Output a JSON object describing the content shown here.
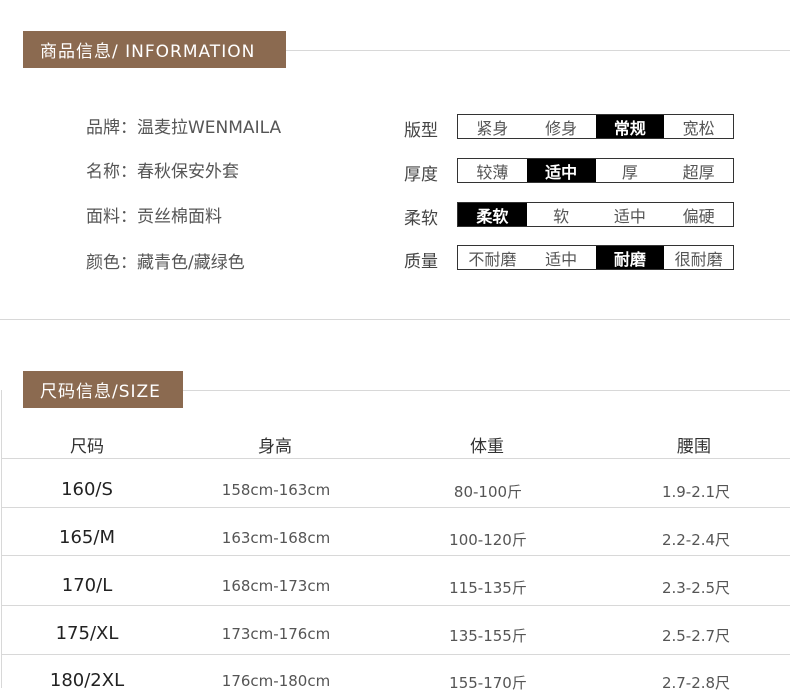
{
  "info_section": {
    "tag": "商品信息/ INFORMATION",
    "rows": [
      {
        "label": "品牌：",
        "value": "温麦拉WENMAILA"
      },
      {
        "label": "名称：",
        "value": "春秋保安外套"
      },
      {
        "label": "面料：",
        "value": "贡丝棉面料"
      },
      {
        "label": "颜色：",
        "value": "藏青色/藏绿色"
      }
    ]
  },
  "attributes": [
    {
      "label": "版型",
      "options": [
        "紧身",
        "修身",
        "常规",
        "宽松"
      ],
      "selected": 2
    },
    {
      "label": "厚度",
      "options": [
        "较薄",
        "适中",
        "厚",
        "超厚"
      ],
      "selected": 1
    },
    {
      "label": "柔软",
      "options": [
        "柔软",
        "软",
        "适中",
        "偏硬"
      ],
      "selected": 0
    },
    {
      "label": "质量",
      "options": [
        "不耐磨",
        "适中",
        "耐磨",
        "很耐磨"
      ],
      "selected": 2
    }
  ],
  "size_section": {
    "tag": "尺码信息/SIZE",
    "headers": [
      "尺码",
      "身高",
      "体重",
      "腰围"
    ],
    "rows": [
      [
        "160/S",
        "158cm-163cm",
        "80-100斤",
        "1.9-2.1尺"
      ],
      [
        "165/M",
        "163cm-168cm",
        "100-120斤",
        "2.2-2.4尺"
      ],
      [
        "170/L",
        "168cm-173cm",
        "115-135斤",
        "2.3-2.5尺"
      ],
      [
        "175/XL",
        "173cm-176cm",
        "135-155斤",
        "2.5-2.7尺"
      ],
      [
        "180/2XL",
        "176cm-180cm",
        "155-170斤",
        "2.7-2.8尺"
      ]
    ]
  },
  "colors": {
    "tag_bg": "#8b6a50",
    "selected_bg": "#000000",
    "line": "#d8d8d8"
  }
}
